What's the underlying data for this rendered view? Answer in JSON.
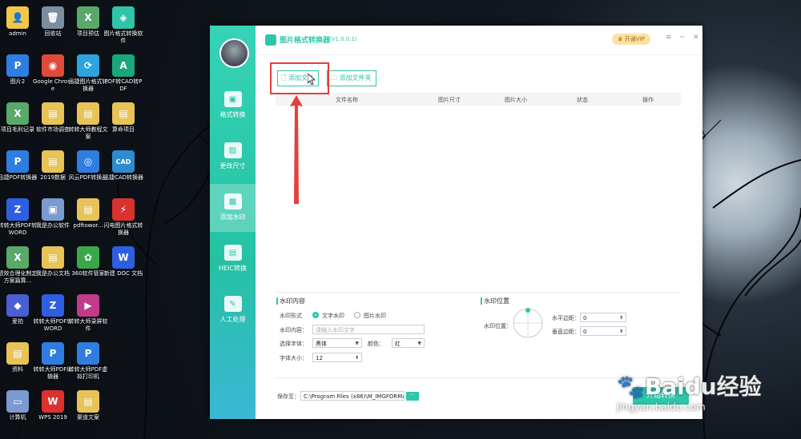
{
  "desktop_icons": [
    {
      "label": "admin",
      "color": "#f3c64a",
      "glyph": "👤"
    },
    {
      "label": "回收站",
      "color": "#7a8ea0",
      "glyph": "🗑"
    },
    {
      "label": "项目预估",
      "color": "#5aa86a",
      "glyph": "X"
    },
    {
      "label": "图片格式转换软件",
      "color": "#2dc6a9",
      "glyph": "◈"
    },
    {
      "label": "图片2",
      "color": "#2f7de1",
      "glyph": "P"
    },
    {
      "label": "Google Chrome",
      "color": "#e04a3a",
      "glyph": "◉"
    },
    {
      "label": "迅捷图片格式转换器",
      "color": "#2da3e0",
      "glyph": "⟳"
    },
    {
      "label": "PDF转CAD转PDF",
      "color": "#1aa77b",
      "glyph": "A"
    },
    {
      "label": "项目毛利记录",
      "color": "#5aa86a",
      "glyph": "X"
    },
    {
      "label": "软件市场调查",
      "color": "#e8c357",
      "glyph": "▤"
    },
    {
      "label": "转转大师教程文案",
      "color": "#e8c357",
      "glyph": "▤"
    },
    {
      "label": "算命项目",
      "color": "#e8c357",
      "glyph": "▤"
    },
    {
      "label": "迅捷PDF转换器",
      "color": "#2f7de1",
      "glyph": "P"
    },
    {
      "label": "2019数据",
      "color": "#e8c357",
      "glyph": "▤"
    },
    {
      "label": "风云PDF转换器",
      "color": "#2f7de1",
      "glyph": "◎"
    },
    {
      "label": "迅捷CAD转换器",
      "color": "#2f8ad0",
      "glyph": "CAD"
    },
    {
      "label": "转转大师PDF转WORD",
      "color": "#2f5fe1",
      "glyph": "Z"
    },
    {
      "label": "我是办公软件",
      "color": "#7a9ad0",
      "glyph": "▣"
    },
    {
      "label": "pdftowor...",
      "color": "#e8c357",
      "glyph": "▤"
    },
    {
      "label": "闪电图片格式转换器",
      "color": "#d9322f",
      "glyph": "⚡"
    },
    {
      "label": "绩效合理化制定方案篇算...",
      "color": "#5aa86a",
      "glyph": "X"
    },
    {
      "label": "我是办公文档",
      "color": "#e8c357",
      "glyph": "▤"
    },
    {
      "label": "360软件管家",
      "color": "#3aa84a",
      "glyph": "✿"
    },
    {
      "label": "新建 DOC 文档",
      "color": "#2f5fe1",
      "glyph": "W"
    },
    {
      "label": "爱拍",
      "color": "#4a5fd0",
      "glyph": "◆"
    },
    {
      "label": "转转大师PDF转WORD",
      "color": "#2f5fe1",
      "glyph": "Z"
    },
    {
      "label": "转转大师录屏软件",
      "color": "#c23b8a",
      "glyph": "▶"
    },
    {
      "label": "",
      "color": "",
      "glyph": ""
    },
    {
      "label": "资料",
      "color": "#e8c357",
      "glyph": "▤"
    },
    {
      "label": "转转大师PDF编辑器",
      "color": "#2f7de1",
      "glyph": "P"
    },
    {
      "label": "转转大师PDF虚拟打印机",
      "color": "#2f7de1",
      "glyph": "P"
    },
    {
      "label": "",
      "color": "",
      "glyph": ""
    },
    {
      "label": "计算机",
      "color": "#7a9ad0",
      "glyph": "▭"
    },
    {
      "label": "WPS 2019",
      "color": "#d9322f",
      "glyph": "W"
    },
    {
      "label": "渠道文案",
      "color": "#e8c357",
      "glyph": "▤"
    }
  ],
  "app": {
    "title": "图片格式转换器",
    "version": "(V1.0.0.1)",
    "vip_label": "开通VIP",
    "minimize": "─",
    "close": "✕",
    "menu": "≡"
  },
  "sidebar": {
    "items": [
      {
        "label": "格式转换",
        "icon": "image-convert-icon",
        "glyph": "▣",
        "active": false
      },
      {
        "label": "更改尺寸",
        "icon": "resize-icon",
        "glyph": "▨",
        "active": false
      },
      {
        "label": "添加水印",
        "icon": "watermark-icon",
        "glyph": "▩",
        "active": true
      },
      {
        "label": "HEIC转换",
        "icon": "heic-icon",
        "glyph": "▤",
        "active": false
      },
      {
        "label": "人工处理",
        "icon": "manual-icon",
        "glyph": "✎",
        "active": false
      }
    ]
  },
  "toolbar": {
    "add_file": "添加文件",
    "add_folder": "添加文件夹"
  },
  "table": {
    "headers": [
      "文件名称",
      "图片尺寸",
      "图片大小",
      "状态",
      "操作"
    ]
  },
  "watermark": {
    "section_title": "水印内容",
    "type_label": "水印形式",
    "option_text": "文字水印",
    "option_image": "图片水印",
    "content_label": "水印内容：",
    "content_placeholder": "请输入水印文字",
    "font_label": "选择字体：",
    "font_value": "黑体",
    "color_label": "颜色：",
    "color_value": "红",
    "size_label": "字体大小：",
    "size_value": "12"
  },
  "position": {
    "section_title": "水印位置",
    "pos_label": "水印位置：",
    "h_label": "水平边距：",
    "h_value": "0",
    "v_label": "垂直边距：",
    "v_value": "0"
  },
  "save": {
    "label": "保存至：",
    "path": "C:\\Program Files (x86)\\M_IMGFORMA",
    "browse": "···",
    "start": "开始转换"
  },
  "watermark_logo": {
    "text": "Baidu经验",
    "url": "jingyan.baidu.com"
  }
}
